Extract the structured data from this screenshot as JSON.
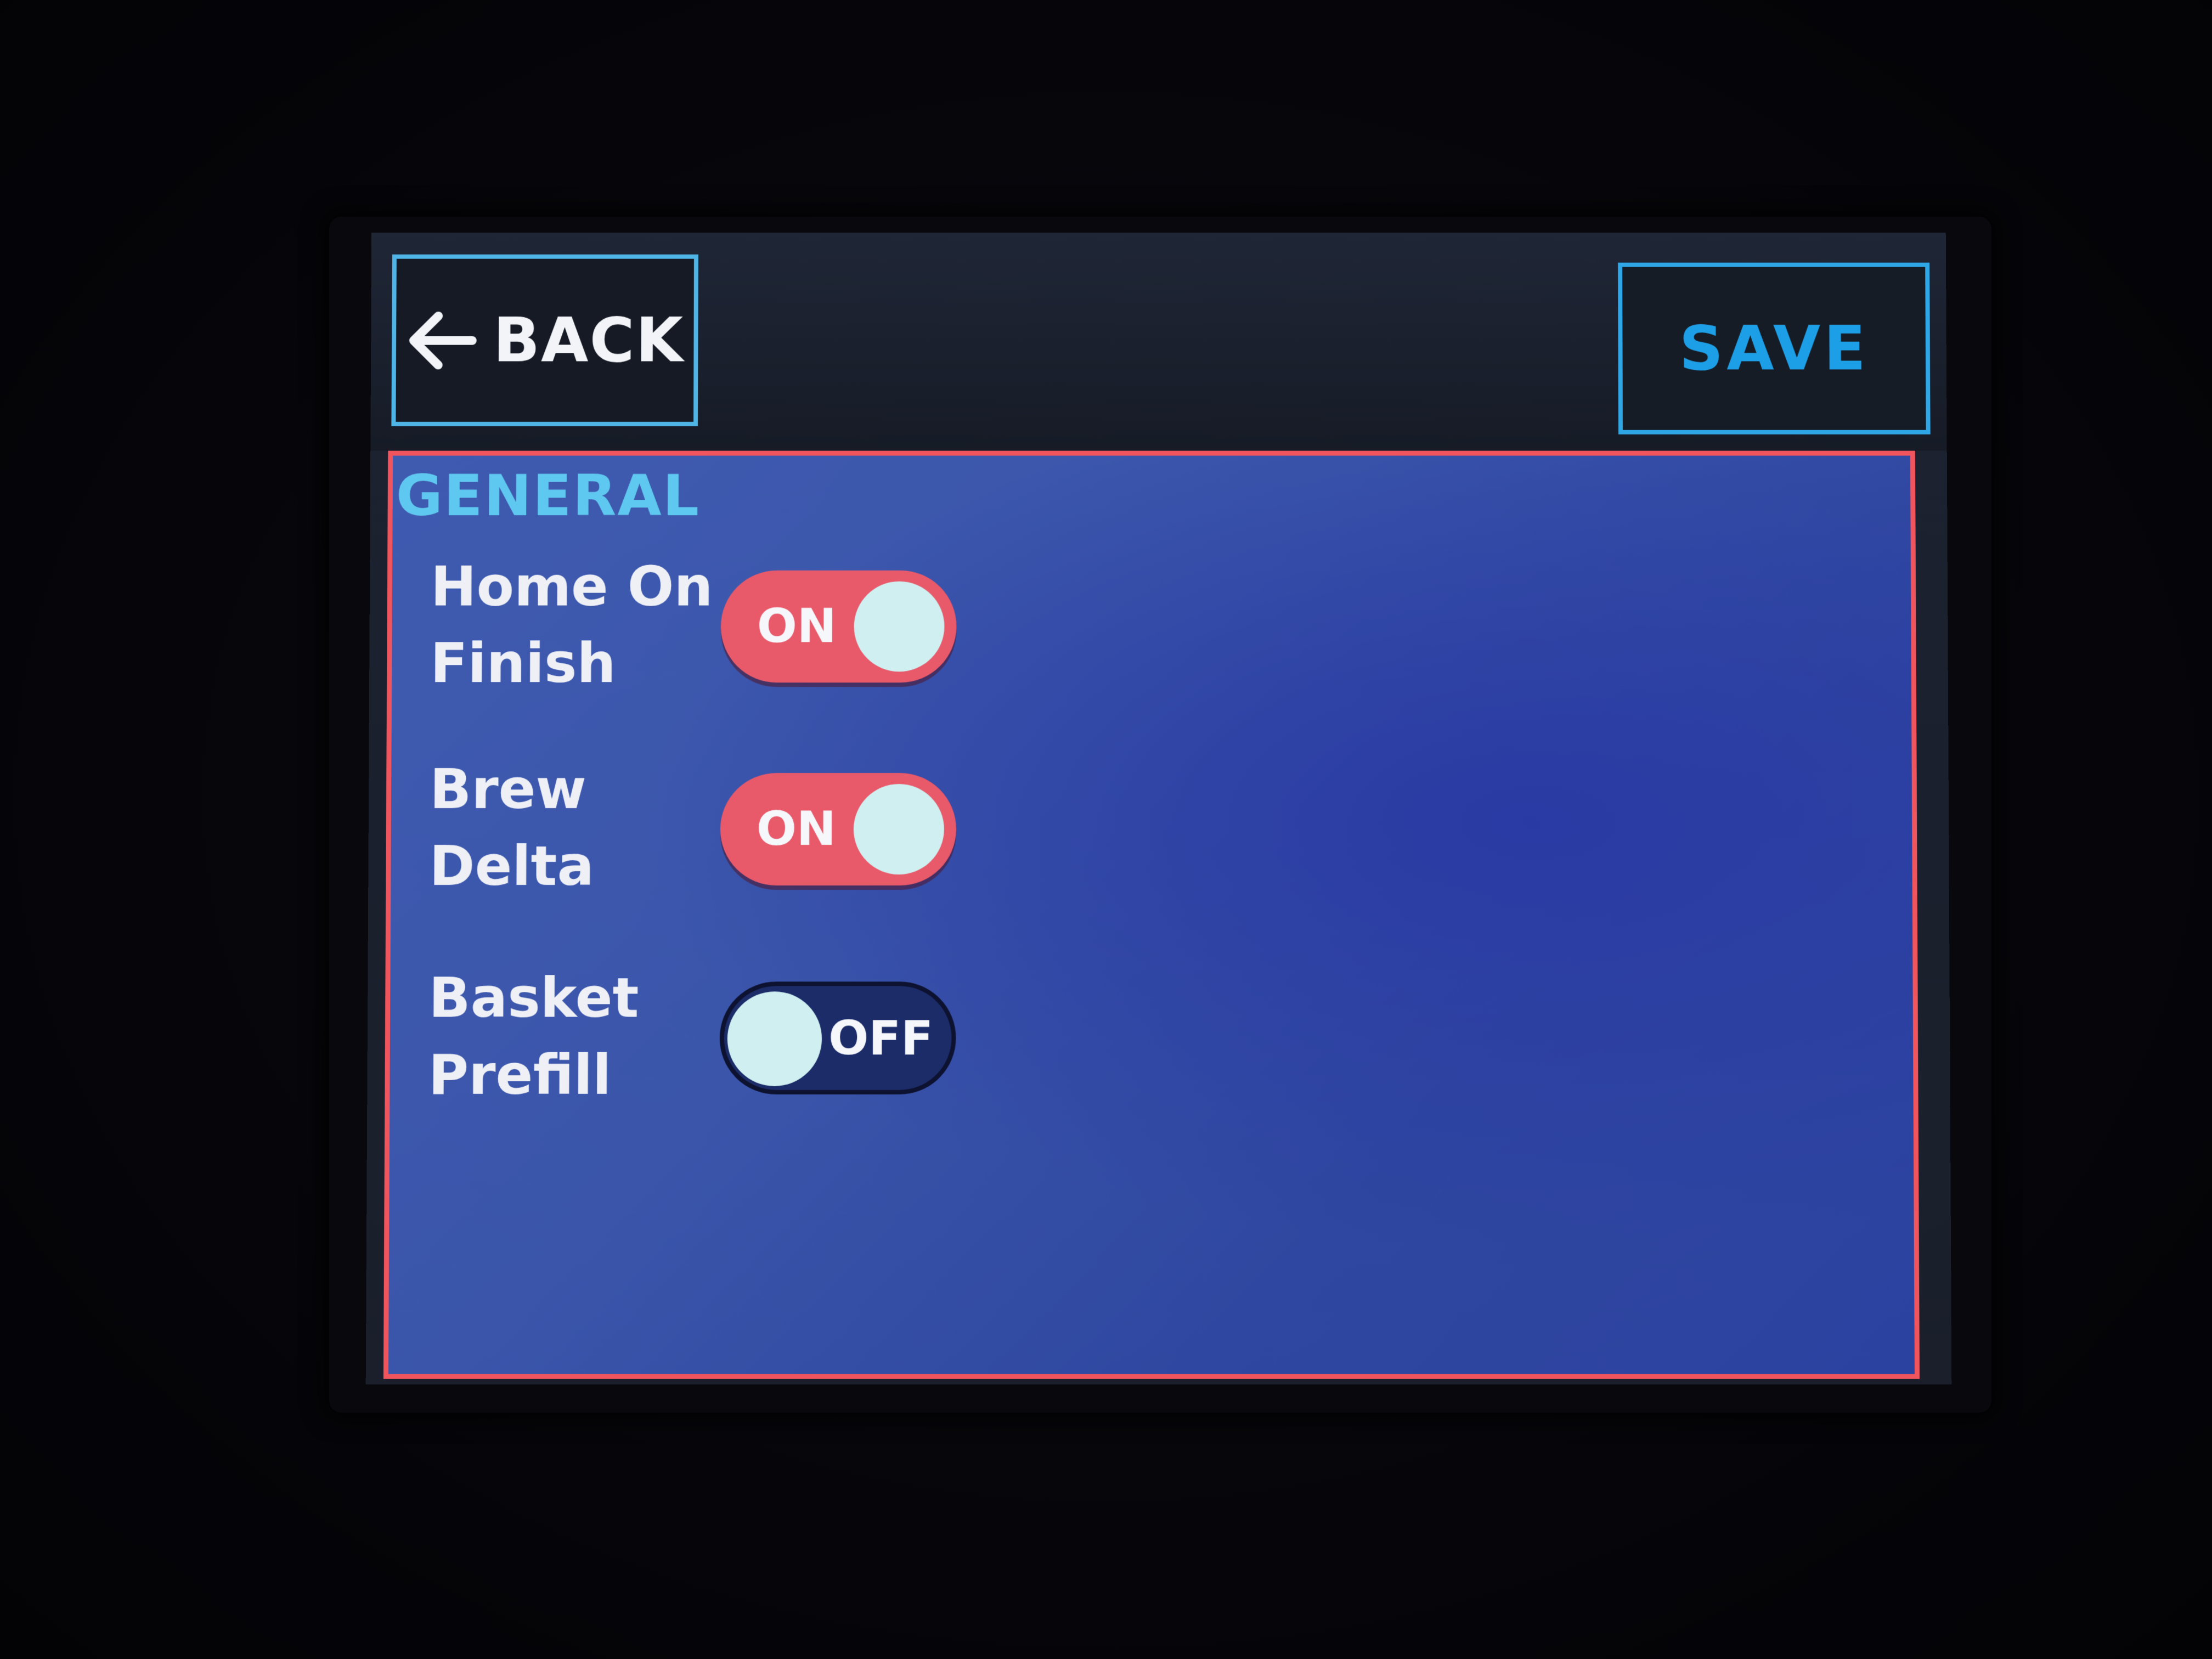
{
  "header": {
    "back_label": "BACK",
    "save_label": "SAVE"
  },
  "panel": {
    "section_title": "GENERAL",
    "settings": [
      {
        "label": "Home On\nFinish",
        "state": "ON",
        "enabled": true
      },
      {
        "label": "Brew\nDelta",
        "state": "ON",
        "enabled": true
      },
      {
        "label": "Basket\nPrefill",
        "state": "OFF",
        "enabled": false
      }
    ]
  },
  "colors": {
    "panel_border": "#f0545c",
    "toggle_on": "#e8596a",
    "toggle_off": "#1b2c68",
    "accent_blue": "#1d9fe8",
    "section_title": "#5fc8f0"
  },
  "icons": {
    "back": "arrow-left-icon"
  }
}
